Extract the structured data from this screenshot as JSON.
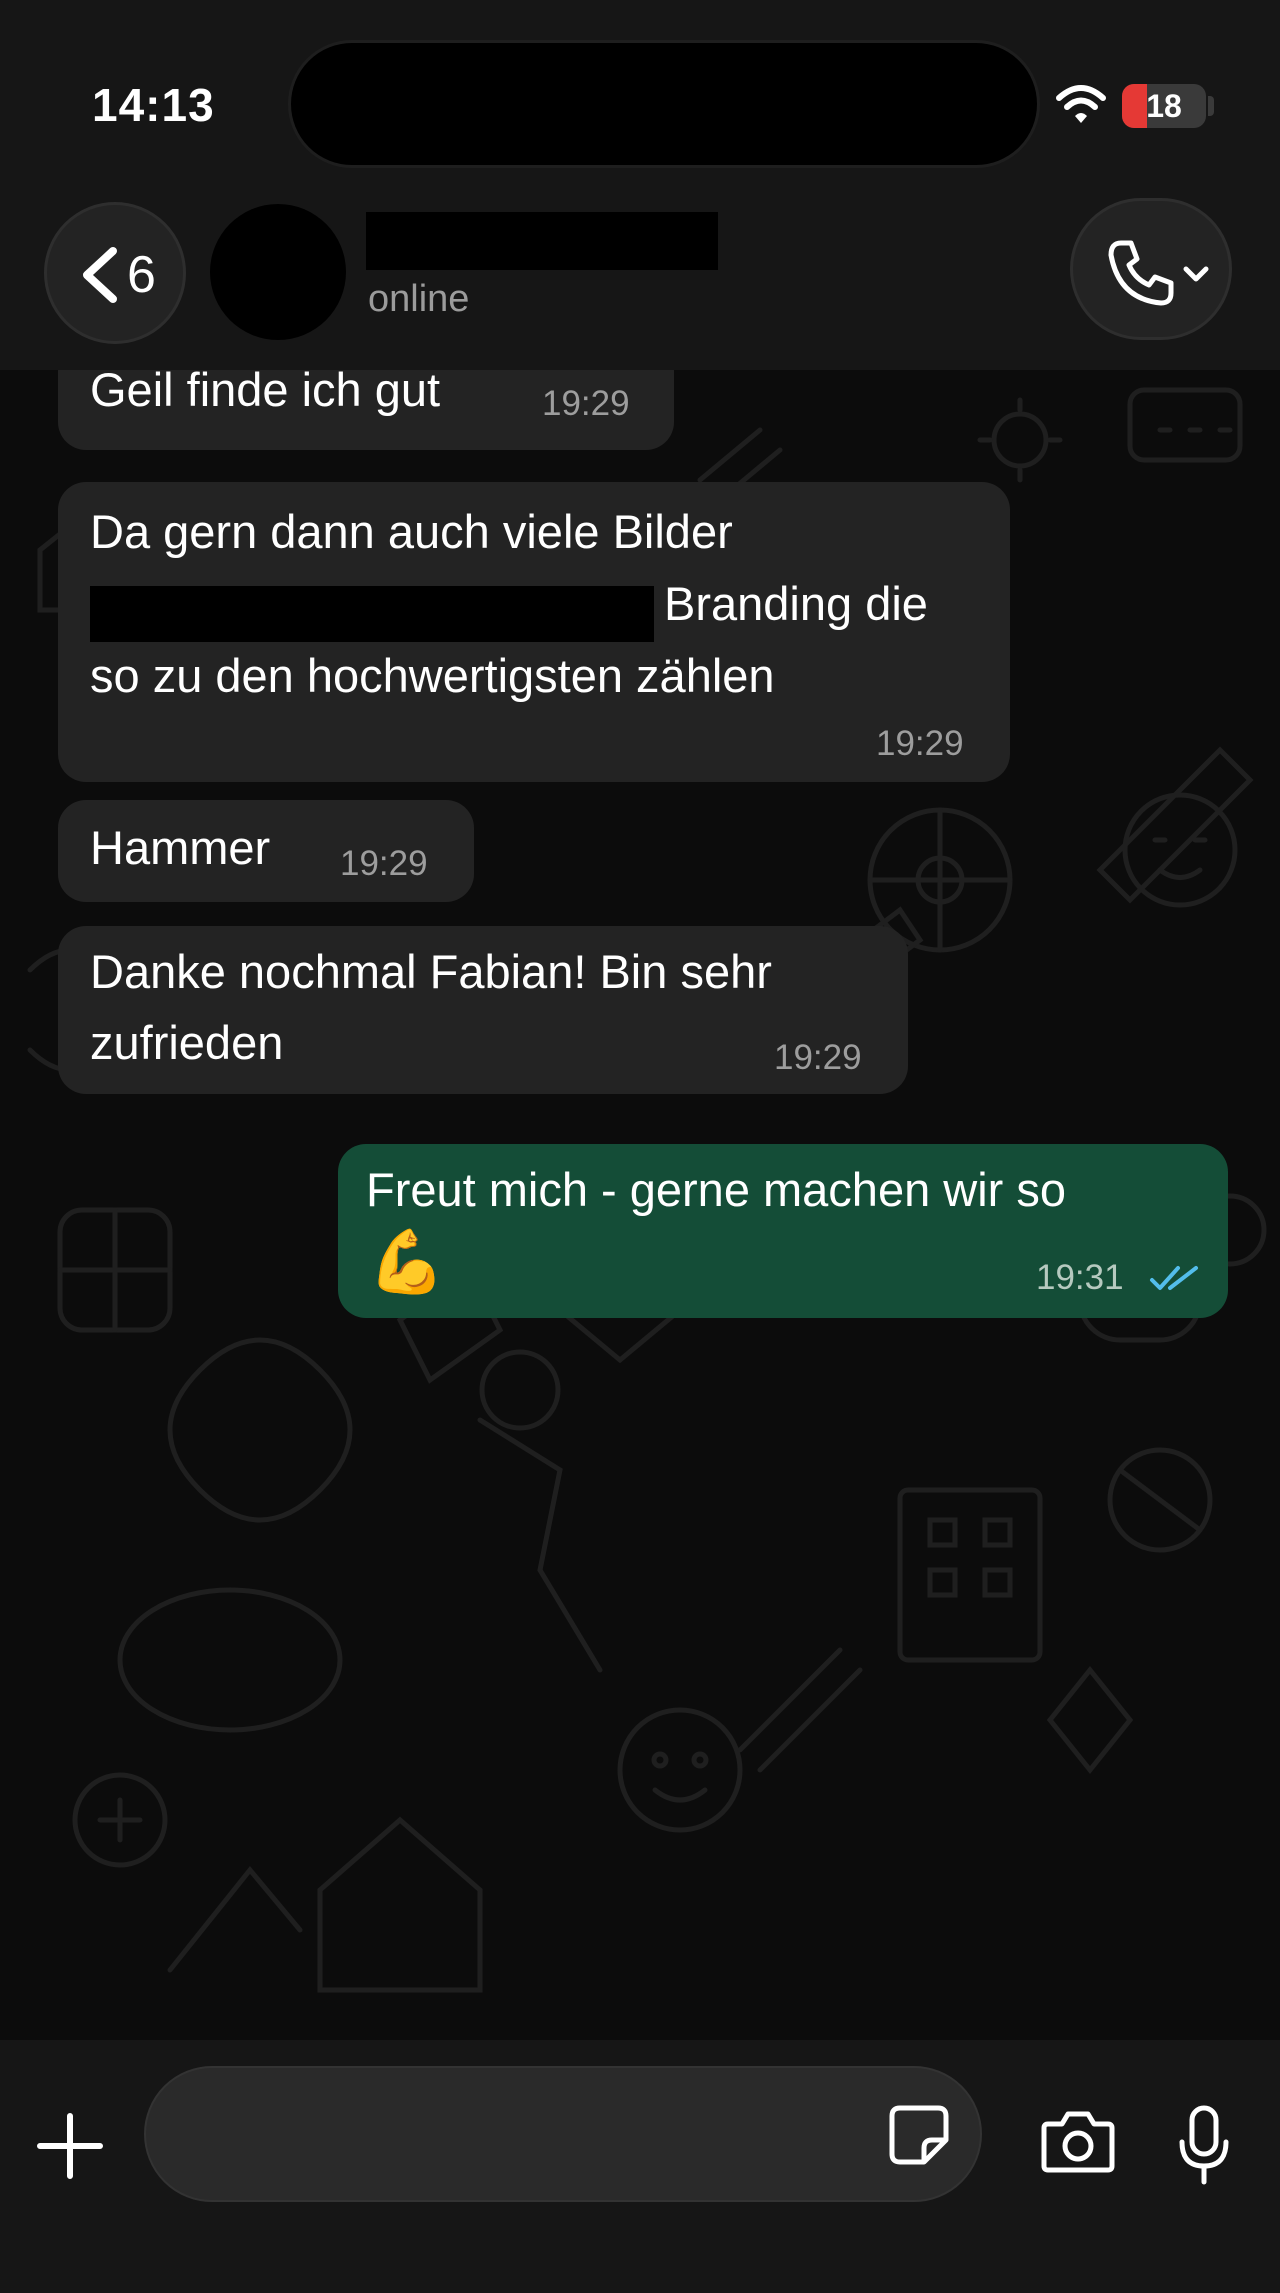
{
  "status_bar": {
    "time": "14:13",
    "battery_level": "18",
    "battery_color": "#e53935"
  },
  "header": {
    "back_count": "6",
    "contact_status": "online"
  },
  "messages": [
    {
      "direction": "incoming",
      "text": "Geil finde ich gut",
      "time": "19:29"
    },
    {
      "direction": "incoming",
      "lines": [
        "Da gern dann auch viele Bilder",
        "Branding die",
        "so zu den hochwertigsten zählen"
      ],
      "time": "19:29"
    },
    {
      "direction": "incoming",
      "text": "Hammer",
      "time": "19:29"
    },
    {
      "direction": "incoming",
      "lines": [
        "Danke nochmal Fabian! Bin sehr",
        "zufrieden"
      ],
      "time": "19:29"
    },
    {
      "direction": "outgoing",
      "text": "Freut mich - gerne machen wir so",
      "emoji": "💪",
      "time": "19:31",
      "status_icon": "double-check-icon",
      "status_color": "#53bdeb"
    }
  ],
  "colors": {
    "background": "#0c0c0c",
    "bar_background": "#161616",
    "incoming_bubble": "#232323",
    "outgoing_bubble": "#144d37"
  }
}
